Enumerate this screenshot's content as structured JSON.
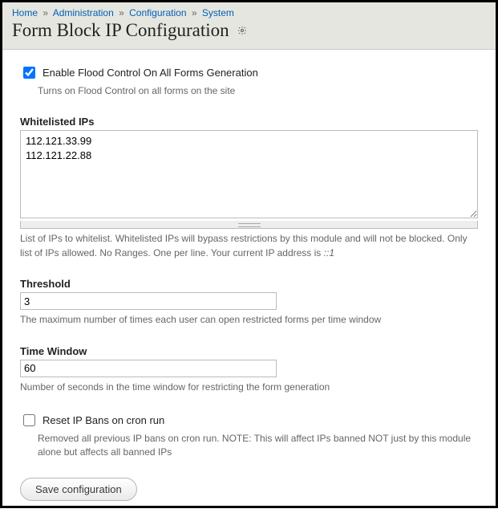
{
  "breadcrumb": {
    "items": [
      "Home",
      "Administration",
      "Configuration",
      "System"
    ],
    "sep": "»"
  },
  "page_title": "Form Block IP Configuration",
  "enable_flood": {
    "label": "Enable Flood Control On All Forms Generation",
    "description": "Turns on Flood Control on all forms on the site",
    "checked": true
  },
  "whitelist": {
    "label": "Whitelisted IPs",
    "value": "112.121.33.99\n112.121.22.88",
    "description_prefix": "List of IPs to whitelist. Whitelisted IPs will bypass restrictions by this module and will not be blocked. Only list of IPs allowed. No Ranges. One per line. Your current IP address is ",
    "current_ip": "::1"
  },
  "threshold": {
    "label": "Threshold",
    "value": "3",
    "description": "The maximum number of times each user can open restricted forms per time window"
  },
  "time_window": {
    "label": "Time Window",
    "value": "60",
    "description": "Number of seconds in the time window for restricting the form generation"
  },
  "reset_bans": {
    "label": "Reset IP Bans on cron run",
    "description": "Removed all previous IP bans on cron run. NOTE: This will affect IPs banned NOT just by this module alone but affects all banned IPs",
    "checked": false
  },
  "actions": {
    "save_label": "Save configuration"
  }
}
